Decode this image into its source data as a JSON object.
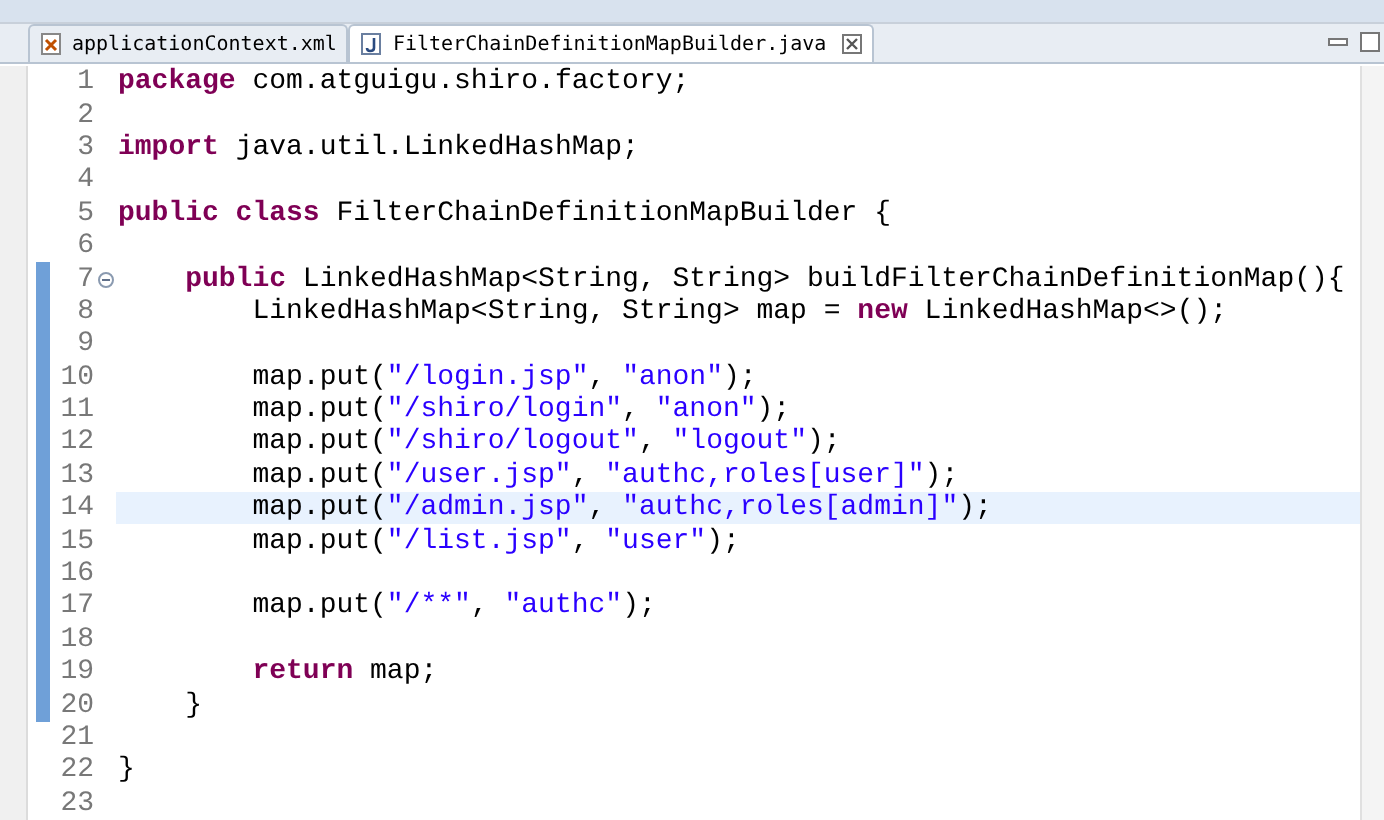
{
  "tabs": [
    {
      "label": "applicationContext.xml",
      "kind": "xml",
      "selected": false
    },
    {
      "label": "FilterChainDefinitionMapBuilder.java",
      "kind": "java",
      "selected": true
    }
  ],
  "editor": {
    "lines": [
      {
        "number": "1",
        "changed": false,
        "current": false,
        "tokens": [
          {
            "text": "package",
            "kind": "keyword"
          },
          {
            "text": " com.atguigu.shiro.factory;",
            "kind": "plain"
          }
        ]
      },
      {
        "number": "2",
        "changed": false,
        "current": false
      },
      {
        "number": "3",
        "changed": false,
        "current": false,
        "tokens": [
          {
            "text": "import",
            "kind": "keyword"
          },
          {
            "text": " java.util.LinkedHashMap;",
            "kind": "plain"
          }
        ]
      },
      {
        "number": "4",
        "changed": false,
        "current": false
      },
      {
        "number": "5",
        "changed": false,
        "current": false,
        "tokens": [
          {
            "text": "public class",
            "kind": "keyword"
          },
          {
            "text": " FilterChainDefinitionMapBuilder {",
            "kind": "plain"
          }
        ]
      },
      {
        "number": "6",
        "changed": false,
        "current": false
      },
      {
        "number": "7",
        "changed": true,
        "current": false,
        "fold": true,
        "tokens": [
          {
            "text": "    public",
            "kind": "keyword"
          },
          {
            "text": " LinkedHashMap<String, String> buildFilterChainDefinitionMap(){",
            "kind": "plain"
          }
        ]
      },
      {
        "number": "8",
        "changed": true,
        "current": false,
        "tokens": [
          {
            "text": "        LinkedHashMap<String, String> map = ",
            "kind": "plain"
          },
          {
            "text": "new",
            "kind": "keyword"
          },
          {
            "text": " LinkedHashMap<>();",
            "kind": "plain"
          }
        ]
      },
      {
        "number": "9",
        "changed": true,
        "current": false
      },
      {
        "number": "10",
        "changed": true,
        "current": false,
        "tokens": [
          {
            "text": "        map.put(",
            "kind": "plain"
          },
          {
            "text": "\"/login.jsp\"",
            "kind": "string"
          },
          {
            "text": ", ",
            "kind": "plain"
          },
          {
            "text": "\"anon\"",
            "kind": "string"
          },
          {
            "text": ");",
            "kind": "plain"
          }
        ]
      },
      {
        "number": "11",
        "changed": true,
        "current": false,
        "tokens": [
          {
            "text": "        map.put(",
            "kind": "plain"
          },
          {
            "text": "\"/shiro/login\"",
            "kind": "string"
          },
          {
            "text": ", ",
            "kind": "plain"
          },
          {
            "text": "\"anon\"",
            "kind": "string"
          },
          {
            "text": ");",
            "kind": "plain"
          }
        ]
      },
      {
        "number": "12",
        "changed": true,
        "current": false,
        "tokens": [
          {
            "text": "        map.put(",
            "kind": "plain"
          },
          {
            "text": "\"/shiro/logout\"",
            "kind": "string"
          },
          {
            "text": ", ",
            "kind": "plain"
          },
          {
            "text": "\"logout\"",
            "kind": "string"
          },
          {
            "text": ");",
            "kind": "plain"
          }
        ]
      },
      {
        "number": "13",
        "changed": true,
        "current": false,
        "tokens": [
          {
            "text": "        map.put(",
            "kind": "plain"
          },
          {
            "text": "\"/user.jsp\"",
            "kind": "string"
          },
          {
            "text": ", ",
            "kind": "plain"
          },
          {
            "text": "\"authc,roles[user]\"",
            "kind": "string"
          },
          {
            "text": ");",
            "kind": "plain"
          }
        ]
      },
      {
        "number": "14",
        "changed": true,
        "current": true,
        "tokens": [
          {
            "text": "        map.put(",
            "kind": "plain"
          },
          {
            "text": "\"/admin.jsp\"",
            "kind": "string"
          },
          {
            "text": ", ",
            "kind": "plain"
          },
          {
            "text": "\"authc,roles[admin]\"",
            "kind": "string"
          },
          {
            "text": ");",
            "kind": "plain"
          }
        ]
      },
      {
        "number": "15",
        "changed": true,
        "current": false,
        "tokens": [
          {
            "text": "        map.put(",
            "kind": "plain"
          },
          {
            "text": "\"/list.jsp\"",
            "kind": "string"
          },
          {
            "text": ", ",
            "kind": "plain"
          },
          {
            "text": "\"user\"",
            "kind": "string"
          },
          {
            "text": ");",
            "kind": "plain"
          }
        ]
      },
      {
        "number": "16",
        "changed": true,
        "current": false
      },
      {
        "number": "17",
        "changed": true,
        "current": false,
        "tokens": [
          {
            "text": "        map.put(",
            "kind": "plain"
          },
          {
            "text": "\"/**\"",
            "kind": "string"
          },
          {
            "text": ", ",
            "kind": "plain"
          },
          {
            "text": "\"authc\"",
            "kind": "string"
          },
          {
            "text": ");",
            "kind": "plain"
          }
        ]
      },
      {
        "number": "18",
        "changed": true,
        "current": false
      },
      {
        "number": "19",
        "changed": true,
        "current": false,
        "tokens": [
          {
            "text": "        return",
            "kind": "keyword"
          },
          {
            "text": " map;",
            "kind": "plain"
          }
        ]
      },
      {
        "number": "20",
        "changed": true,
        "current": false,
        "tokens": [
          {
            "text": "    }",
            "kind": "plain"
          }
        ]
      },
      {
        "number": "21",
        "changed": false,
        "current": false
      },
      {
        "number": "22",
        "changed": false,
        "current": false,
        "tokens": [
          {
            "text": "}",
            "kind": "plain"
          }
        ]
      },
      {
        "number": "23",
        "changed": false,
        "current": false
      }
    ]
  }
}
